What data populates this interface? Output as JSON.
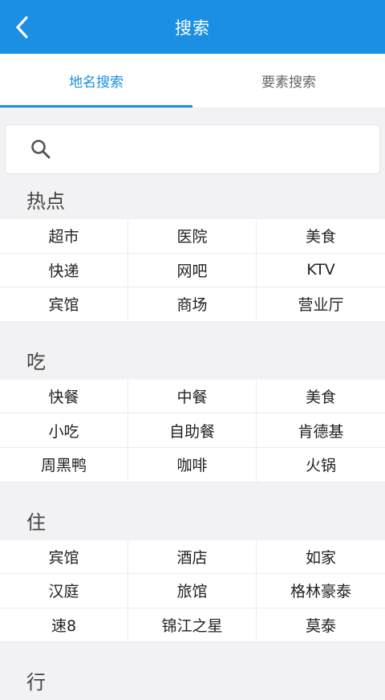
{
  "header": {
    "title": "搜索"
  },
  "tabs": [
    {
      "label": "地名搜索",
      "active": true
    },
    {
      "label": "要素搜索",
      "active": false
    }
  ],
  "search": {
    "value": "",
    "placeholder": ""
  },
  "colors": {
    "accent": "#1a8fe3",
    "background": "#f2f2f4"
  },
  "sections": [
    {
      "title": "热点",
      "items": [
        "超市",
        "医院",
        "美食",
        "快递",
        "网吧",
        "KTV",
        "宾馆",
        "商场",
        "营业厅"
      ]
    },
    {
      "title": "吃",
      "items": [
        "快餐",
        "中餐",
        "美食",
        "小吃",
        "自助餐",
        "肯德基",
        "周黑鸭",
        "咖啡",
        "火锅"
      ]
    },
    {
      "title": "住",
      "items": [
        "宾馆",
        "酒店",
        "如家",
        "汉庭",
        "旅馆",
        "格林豪泰",
        "速8",
        "锦江之星",
        "莫泰"
      ]
    },
    {
      "title": "行",
      "items": []
    }
  ]
}
